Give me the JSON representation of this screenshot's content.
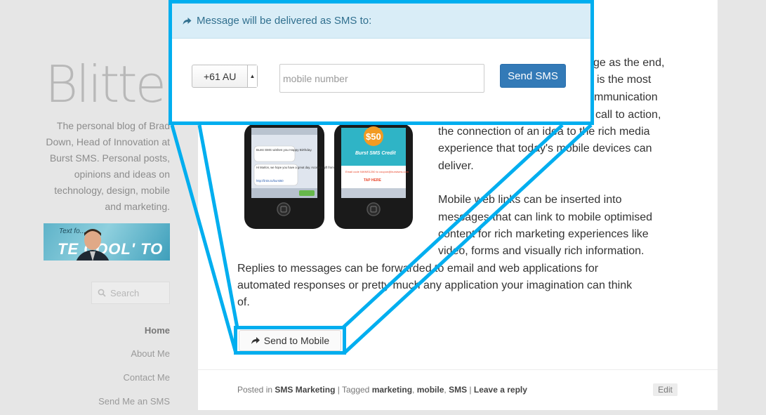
{
  "sidebar": {
    "blog_title": "Blitters",
    "tagline_lines": [
      "The personal blog of Brad",
      "Down, Head of Innovation at",
      "Burst SMS. Personal posts,",
      "opinions and ideas on",
      "technology, design, mobile",
      "and marketing."
    ],
    "banner": {
      "small_text": "Text fo...",
      "big_text": "TE    COOL' TO"
    },
    "search_placeholder": "Search",
    "nav": [
      {
        "label": "Home",
        "active": true
      },
      {
        "label": "About Me",
        "active": false
      },
      {
        "label": "Contact Me",
        "active": false
      },
      {
        "label": "Send Me an SMS",
        "active": false
      }
    ]
  },
  "post": {
    "right_lines": [
      "ge as the end,",
      "is the most",
      "mmunication",
      "call to action,",
      "the connection of an idea to the rich media",
      "experience that today's mobile devices can",
      "deliver."
    ],
    "right_lines_2": [
      "Mobile web links can be inserted into",
      "messages that can link to mobile optimised",
      "content for rich marketing experiences like",
      "video, forms and visually rich information."
    ],
    "full_lines": [
      "Replies to messages can be forwarded to email and web applications for",
      "automated responses or pretty much any application your imagination can think",
      "of."
    ],
    "phone_left": {
      "header": "Burst SMS wishes you Happy Birthday.",
      "body": "Hi Marlon, we hope you have a great day. Accept a gift from us for being a valued customer.",
      "link": "http://links.to/burst50"
    },
    "phone_right": {
      "amount": "$50",
      "credit": "Burst SMS Credit",
      "code_line": "Email code NWMS1250 to coupon@burstsms.com",
      "cta": "TAP HERE"
    },
    "send_to_mobile_label": "Send to Mobile",
    "meta": {
      "posted_in": "Posted in",
      "category": "SMS Marketing",
      "sep1": " | Tagged ",
      "tags": [
        "marketing",
        "mobile",
        "SMS"
      ],
      "sep2": " | ",
      "reply": "Leave a reply"
    },
    "edit_label": "Edit"
  },
  "popup": {
    "header": "Message will be delivered as SMS to:",
    "country_value": "+61 AU",
    "mobile_placeholder": "mobile number",
    "send_label": "Send SMS"
  },
  "colors": {
    "callout": "#00aeef",
    "button": "#337ab7",
    "popup_header_bg": "#d9edf7"
  }
}
